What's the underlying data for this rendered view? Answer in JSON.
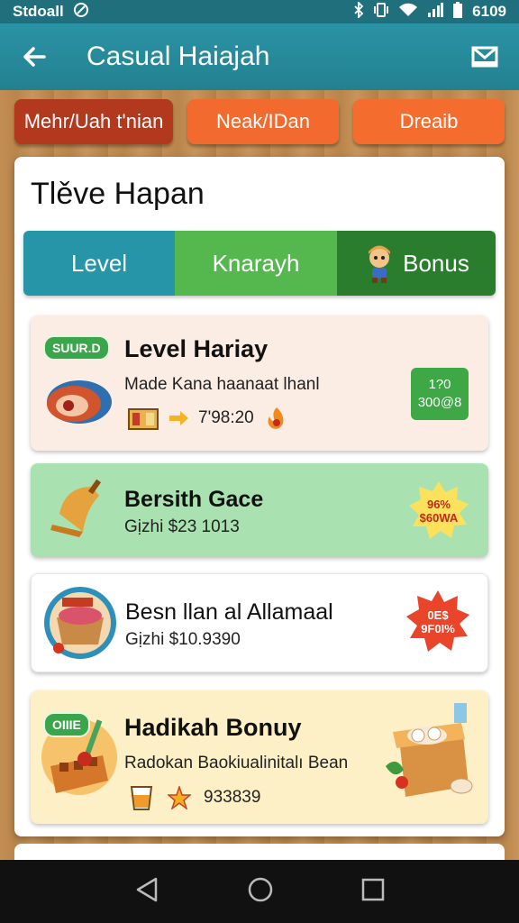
{
  "status_bar": {
    "carrier": "Stdoall",
    "time": "6109"
  },
  "app_bar": {
    "title": "Casual Haiajah"
  },
  "top_chips": [
    "Mehr/Uah t'nian",
    "Neak/IDan",
    "Dreaib"
  ],
  "panel": {
    "title": "Tlěve Hapan",
    "tabs": [
      "Level",
      "Knarayh",
      "Bonus"
    ]
  },
  "cards": [
    {
      "badge": "SUUR.D",
      "title": "Level Hariay",
      "subtitle": "Made Kana haanaat lhanl",
      "meta": "7'98:20",
      "box_top": "1?0",
      "box_bottom": "300@8"
    },
    {
      "title": "Bersith Gace",
      "subtitle": "Gịzhi $23 1013",
      "burst_top": "96%",
      "burst_bottom": "$60WA"
    },
    {
      "title": "Besn llan al Allamaal",
      "subtitle": "Gịzhi $10.9390",
      "burst_top": "0E$",
      "burst_bottom": "9F0I%"
    },
    {
      "badge": "OIIIE",
      "title": "Hadikah Bonuy",
      "subtitle": "Radokan Baokiualinitalı Bean",
      "meta": "933839"
    }
  ],
  "colors": {
    "accent": "#2695a8",
    "green": "#55b84e",
    "orange": "#f26a2d"
  }
}
